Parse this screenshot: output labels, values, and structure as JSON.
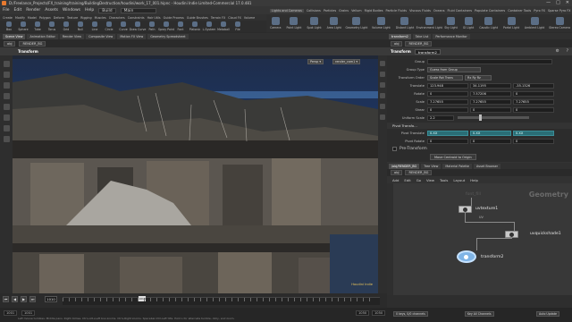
{
  "window": {
    "title": "D:/Freelance_Projects/FX_training/training/BuildingDestruction/houdini/work_17_001.hipnc - Houdini Indie Limited-Commercial 17.0.481",
    "controls": [
      "—",
      "□",
      "✕"
    ]
  },
  "menu": {
    "items": [
      "File",
      "Edit",
      "Render",
      "Assets",
      "Windows",
      "Help"
    ],
    "build": "Build",
    "desk": "Main"
  },
  "left_shelf": {
    "tabs": [
      "Create",
      "Modify",
      "Model",
      "Polygon",
      "Deform",
      "Texture",
      "Rigging",
      "Muscles",
      "Characters",
      "Constraints",
      "Hair Utils",
      "Guide Process",
      "Guide Brushes",
      "Terrain FX",
      "Cloud FX",
      "Volume"
    ],
    "tools": [
      "Box",
      "Sphere",
      "Tube",
      "Torus",
      "Grid",
      "Null",
      "Line",
      "Circle",
      "Curve",
      "Draw Curve",
      "Path",
      "Spray Paint",
      "Font",
      "Platonic",
      "L-System",
      "Metaball",
      "File"
    ]
  },
  "right_shelf": {
    "tabs": [
      "Lights and Cameras",
      "Collisions",
      "Particles",
      "Grains",
      "Vellum",
      "Rigid Bodies",
      "Particle Fluids",
      "Viscous Fluids",
      "Oceans",
      "Fluid Containers",
      "Populate Containers",
      "Container Tools",
      "Pyro FX",
      "Sparse Pyro FX",
      "FEM",
      "Wires",
      "Crowds",
      "Drive Simulation"
    ],
    "tools": [
      "Camera",
      "Point Light",
      "Spot Light",
      "Area Light",
      "Geometry Light",
      "Volume Light",
      "Distant Light",
      "Environment Light",
      "Sky Light",
      "GI Light",
      "Caustic Light",
      "Portal Light",
      "Ambient Light",
      "Stereo Camera",
      "VR Camera",
      "Switcher",
      "Gamepad Camera"
    ]
  },
  "viewer": {
    "tabs": [
      "Scene View",
      "Animation Editor",
      "Render View",
      "Composite View",
      "Motion FX View",
      "Geometry Spreadsheet"
    ],
    "path": [
      "obj",
      "RENDER_BG"
    ],
    "header_title": "Transform",
    "persp": "Persp ▾",
    "cam": "render_cam1 ▾",
    "watermark": "Houdini Indie"
  },
  "timeline": {
    "current_frame": "1010",
    "start": "1001",
    "start2": "1001",
    "end": "1050",
    "end2": "1050",
    "marker": "1010",
    "status_msg": "Left mouse tumbles. Middle pans. Right dollies. Ctrl+Alt+Left box-zooms. Ctrl+Right zooms. Spacebar-Ctrl-Left tilts. Hold L for alternate tumble, dolly, and zoom.",
    "keys_label": "0 keys, 0/0 channels",
    "keyall": "Key All Channels",
    "autoupdate": "Auto Update"
  },
  "params": {
    "tabs": [
      "transform2",
      "Take List",
      "Performance Monitor"
    ],
    "path": [
      "obj",
      "RENDER_BG"
    ],
    "node_type": "Transform",
    "node_name": "transform2",
    "rows": {
      "group_label": "Group",
      "group_type_label": "Group Type",
      "group_type": "Guess from Group",
      "xform_order_label": "Transform Order",
      "xform_order": "Scale Rot Trans",
      "rot_order": "Rx Ry Rz",
      "translate_label": "Translate",
      "translate": [
        "123.948",
        "34.1195",
        "-35.1326"
      ],
      "rotate_label": "Rotate",
      "rotate": [
        "0",
        "7.57206",
        "0"
      ],
      "scale_label": "Scale",
      "scale": [
        "7.27655",
        "7.27655",
        "7.27655"
      ],
      "shear_label": "Shear",
      "shear": [
        "0",
        "0",
        "0"
      ],
      "uniform_label": "Uniform Scale",
      "uniform": "2.2",
      "pivot_section": "Pivot Transfo...",
      "pivot_translate_label": "Pivot Translate",
      "pivot_translate": [
        "0.XX",
        "0.XX",
        "0.XX"
      ],
      "pivot_rotate_label": "Pivot Rotate",
      "pivot_rotate": [
        "0",
        "0",
        "0"
      ],
      "pretransform_section": "Pre-Transform",
      "move_btn": "Move Centroid to Origin",
      "attributes_section": "Attributes"
    }
  },
  "network": {
    "tabs": [
      "/obj/RENDER_BG",
      "Tree View",
      "Material Palette",
      "Asset Browser"
    ],
    "path": [
      "obj",
      "RENDER_BG"
    ],
    "menu": [
      "Add",
      "Edit",
      "Go",
      "View",
      "Tools",
      "Layout",
      "Help"
    ],
    "context_label": "Geometry",
    "nodes": [
      {
        "name": "uvtexture1"
      },
      {
        "name": "uvquickshade1"
      },
      {
        "name": "transform2"
      }
    ],
    "wire_label": "UV",
    "ghost_label": "font_fill"
  }
}
